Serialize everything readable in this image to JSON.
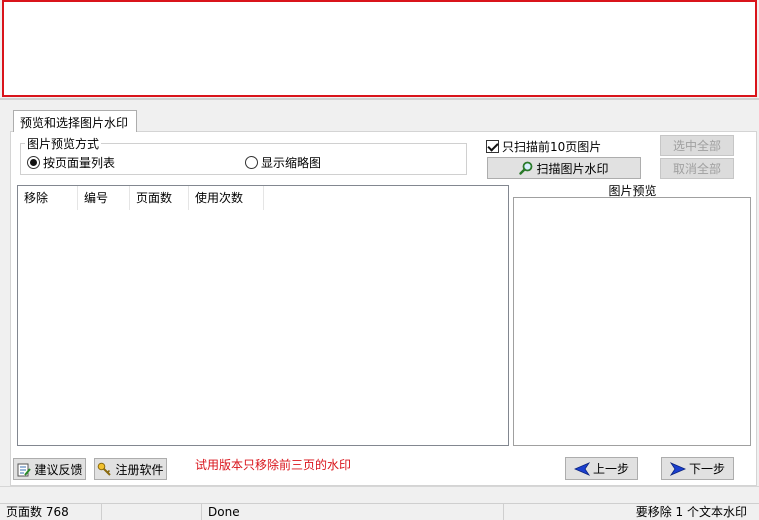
{
  "tab": {
    "label": "预览和选择图片水印"
  },
  "preview_mode": {
    "legend": "图片预览方式",
    "option_list": "按页面量列表",
    "option_thumb": "显示缩略图",
    "selected": "option_list"
  },
  "scan": {
    "checkbox_label": "只扫描前10页图片",
    "checked": true,
    "button_label": "扫描图片水印"
  },
  "selection": {
    "select_all": "选中全部",
    "cancel_all": "取消全部"
  },
  "list": {
    "columns": [
      "移除",
      "编号",
      "页面数",
      "使用次数"
    ]
  },
  "preview": {
    "label": "图片预览"
  },
  "footer": {
    "feedback": "建议反馈",
    "register": "注册软件",
    "trial_note": "试用版本只移除前三页的水印",
    "prev": "上一步",
    "next": "下一步"
  },
  "status": {
    "pages": "页面数 768",
    "state": "Done",
    "summary": "要移除 1 个文本水印"
  },
  "colors": {
    "accent_red": "#d9141b",
    "nav_blue": "#1a3fd0"
  }
}
